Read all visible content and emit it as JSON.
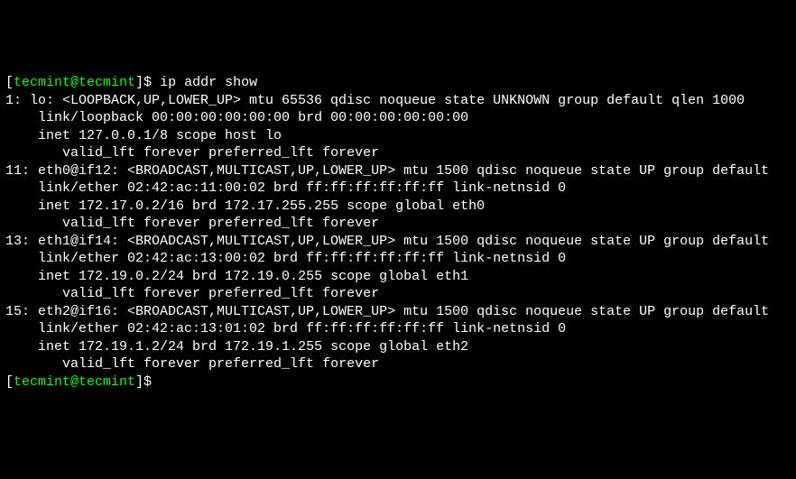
{
  "prompt": {
    "open": "[",
    "user_host": "tecmint@tecmint",
    "close": "]$ "
  },
  "command": "ip addr show",
  "lines": [
    "1: lo: <LOOPBACK,UP,LOWER_UP> mtu 65536 qdisc noqueue state UNKNOWN group default qlen 1000",
    "    link/loopback 00:00:00:00:00:00 brd 00:00:00:00:00:00",
    "    inet 127.0.0.1/8 scope host lo",
    "       valid_lft forever preferred_lft forever",
    "11: eth0@if12: <BROADCAST,MULTICAST,UP,LOWER_UP> mtu 1500 qdisc noqueue state UP group default ",
    "    link/ether 02:42:ac:11:00:02 brd ff:ff:ff:ff:ff:ff link-netnsid 0",
    "    inet 172.17.0.2/16 brd 172.17.255.255 scope global eth0",
    "       valid_lft forever preferred_lft forever",
    "13: eth1@if14: <BROADCAST,MULTICAST,UP,LOWER_UP> mtu 1500 qdisc noqueue state UP group default ",
    "    link/ether 02:42:ac:13:00:02 brd ff:ff:ff:ff:ff:ff link-netnsid 0",
    "    inet 172.19.0.2/24 brd 172.19.0.255 scope global eth1",
    "       valid_lft forever preferred_lft forever",
    "15: eth2@if16: <BROADCAST,MULTICAST,UP,LOWER_UP> mtu 1500 qdisc noqueue state UP group default ",
    "    link/ether 02:42:ac:13:01:02 brd ff:ff:ff:ff:ff:ff link-netnsid 0",
    "    inet 172.19.1.2/24 brd 172.19.1.255 scope global eth2",
    "       valid_lft forever preferred_lft forever"
  ]
}
